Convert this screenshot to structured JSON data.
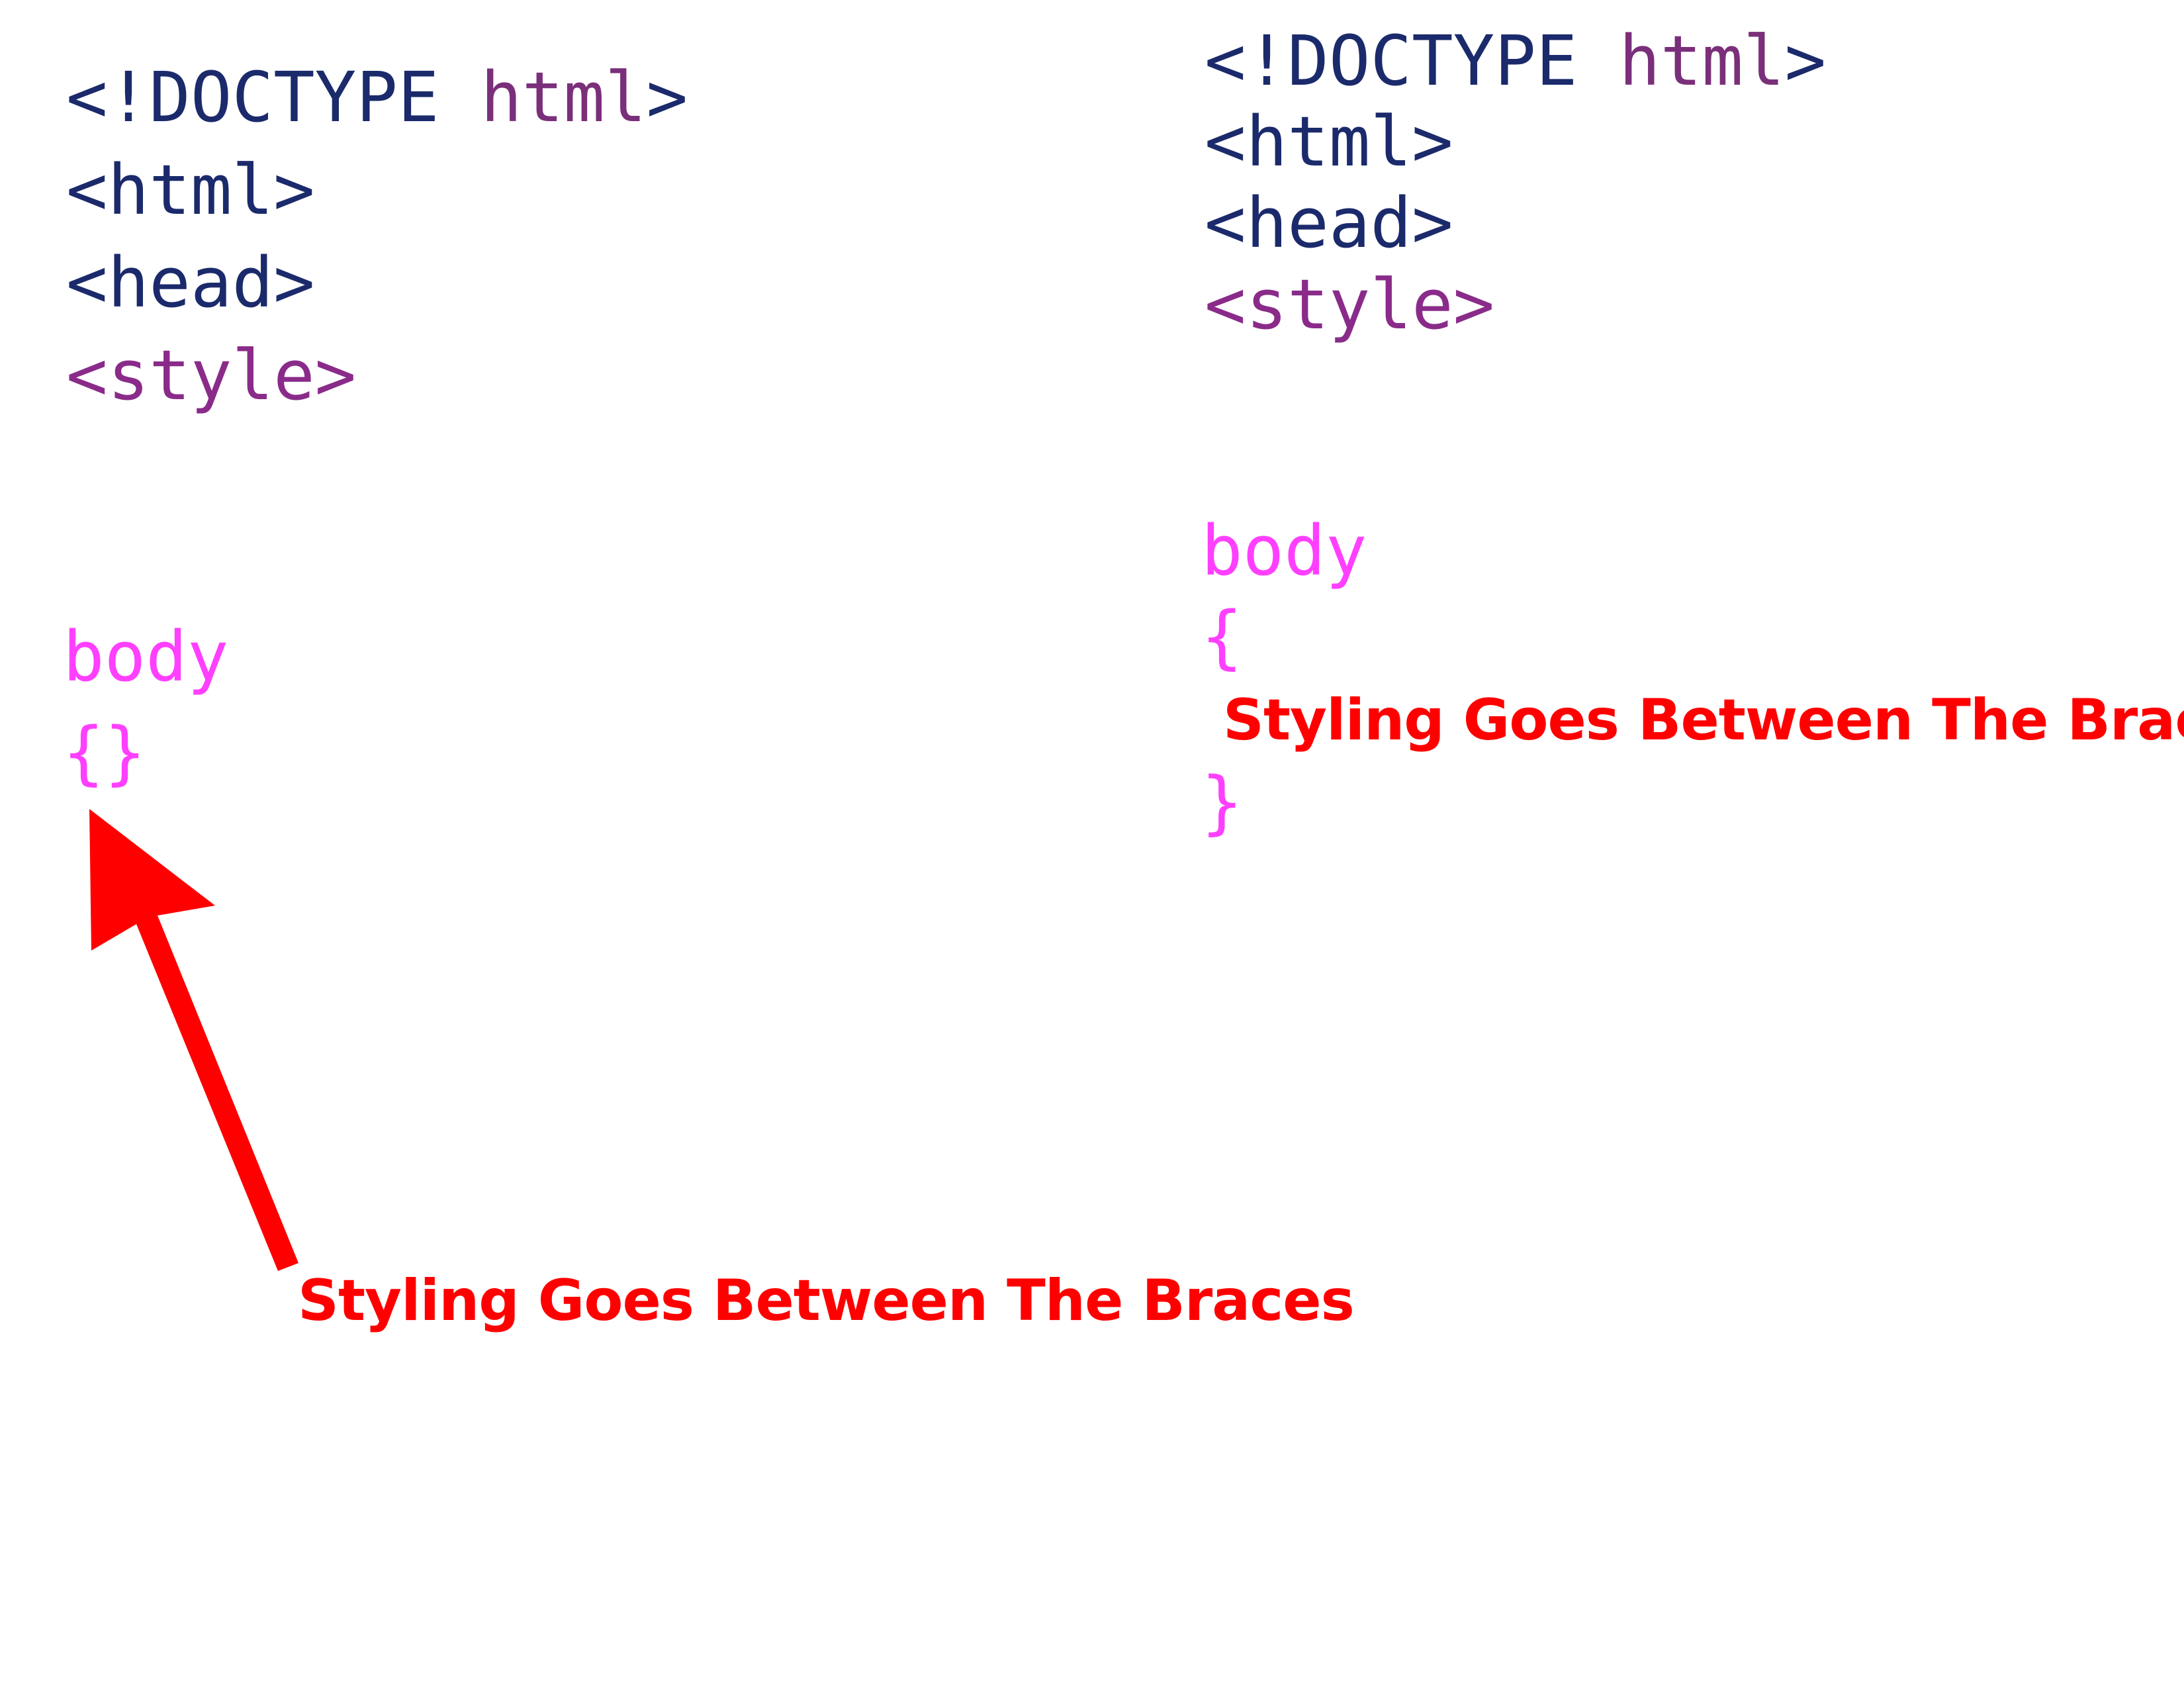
{
  "left_panel": {
    "lines": {
      "doctype_open": "<!DOCTYPE ",
      "doctype_kw": "html",
      "doctype_close": ">",
      "html": "<html>",
      "head": "<head>",
      "style": "<style>",
      "body": "body",
      "braces": "{}"
    },
    "annotation": "Styling Goes Between The Braces"
  },
  "right_panel": {
    "lines": {
      "doctype_open": "<!DOCTYPE ",
      "doctype_kw": "html",
      "doctype_close": ">",
      "html": "<html>",
      "head": "<head>",
      "style": "<style>",
      "body": "body",
      "open_brace": "{",
      "close_brace": "}"
    },
    "annotation": "Styling Goes Between The Braces"
  },
  "colors": {
    "tag": "#1b2a6b",
    "keyword": "#7a2f7a",
    "style_tag": "#8a2b8a",
    "selector": "#ff3fff",
    "annotation": "#ff0000"
  }
}
